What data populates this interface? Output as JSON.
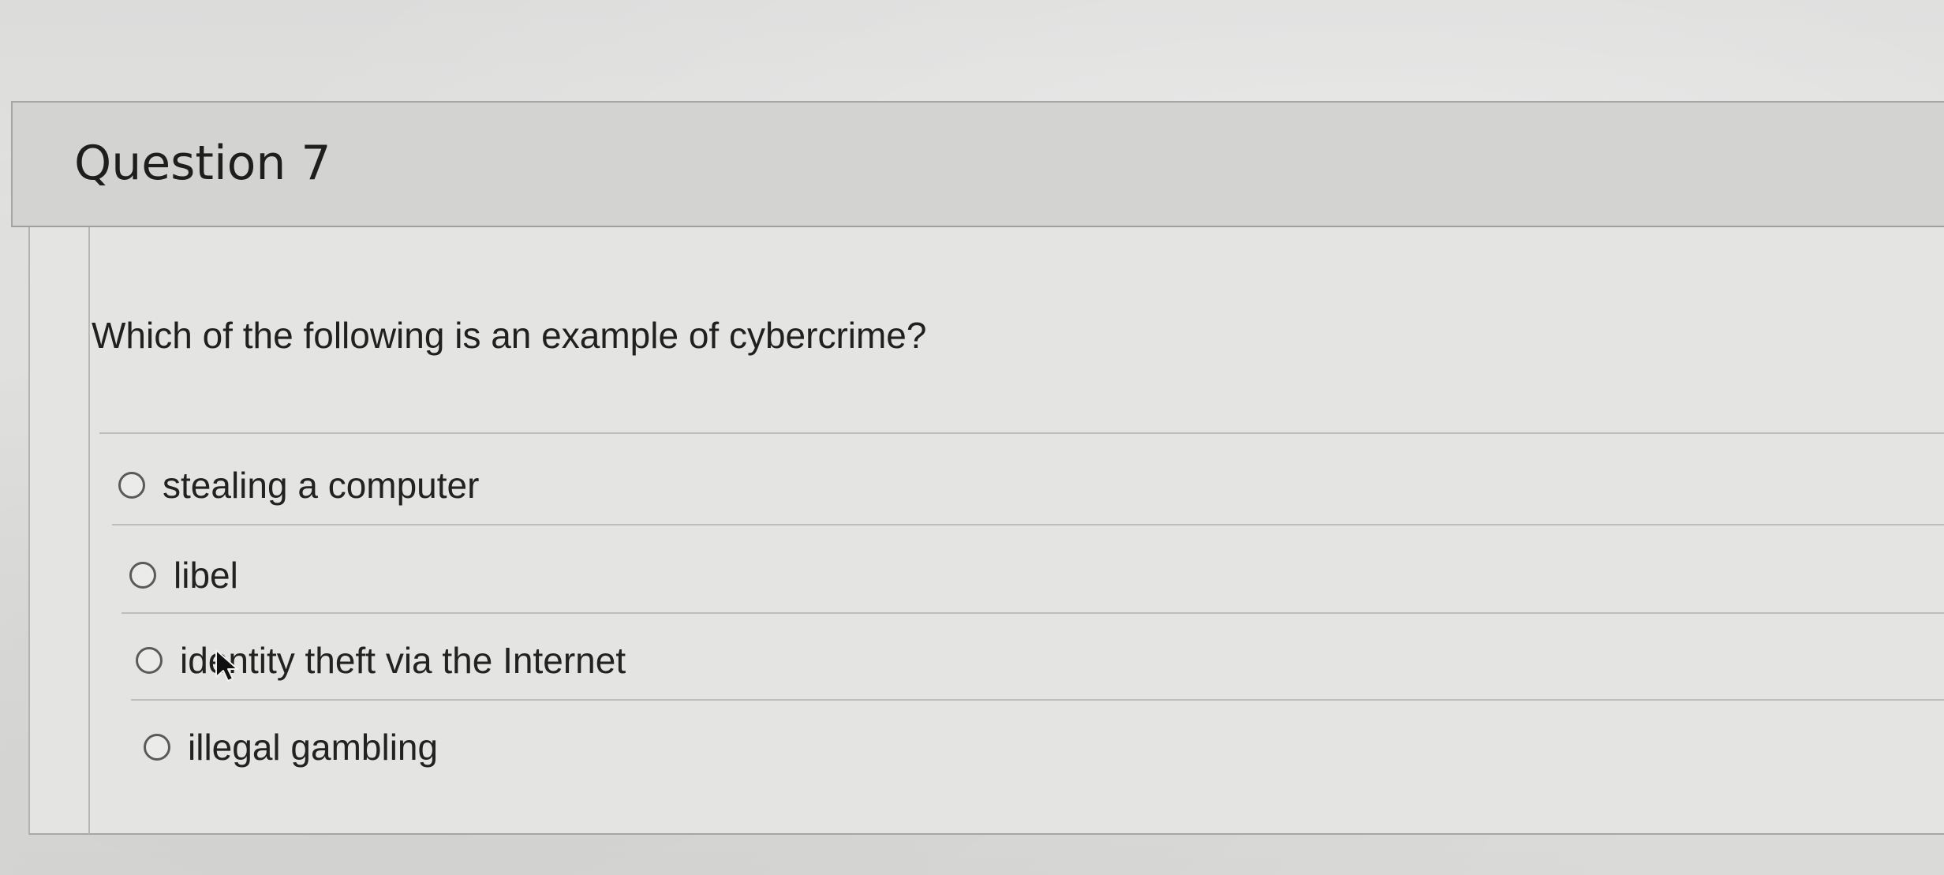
{
  "question": {
    "title": "Question 7",
    "text": "Which of the following is an example of cybercrime?",
    "options": [
      {
        "label": "stealing a computer",
        "selected": false
      },
      {
        "label": "libel",
        "selected": false
      },
      {
        "label": "identity theft via the Internet",
        "selected": false
      },
      {
        "label": "illegal gambling",
        "selected": false
      }
    ]
  },
  "colors": {
    "header_bg": "#d3d3d1",
    "body_bg": "#e4e4e2",
    "text": "#202020"
  },
  "icons": {
    "radio": "radio-unchecked-icon",
    "pointer": "mouse-pointer-icon"
  }
}
